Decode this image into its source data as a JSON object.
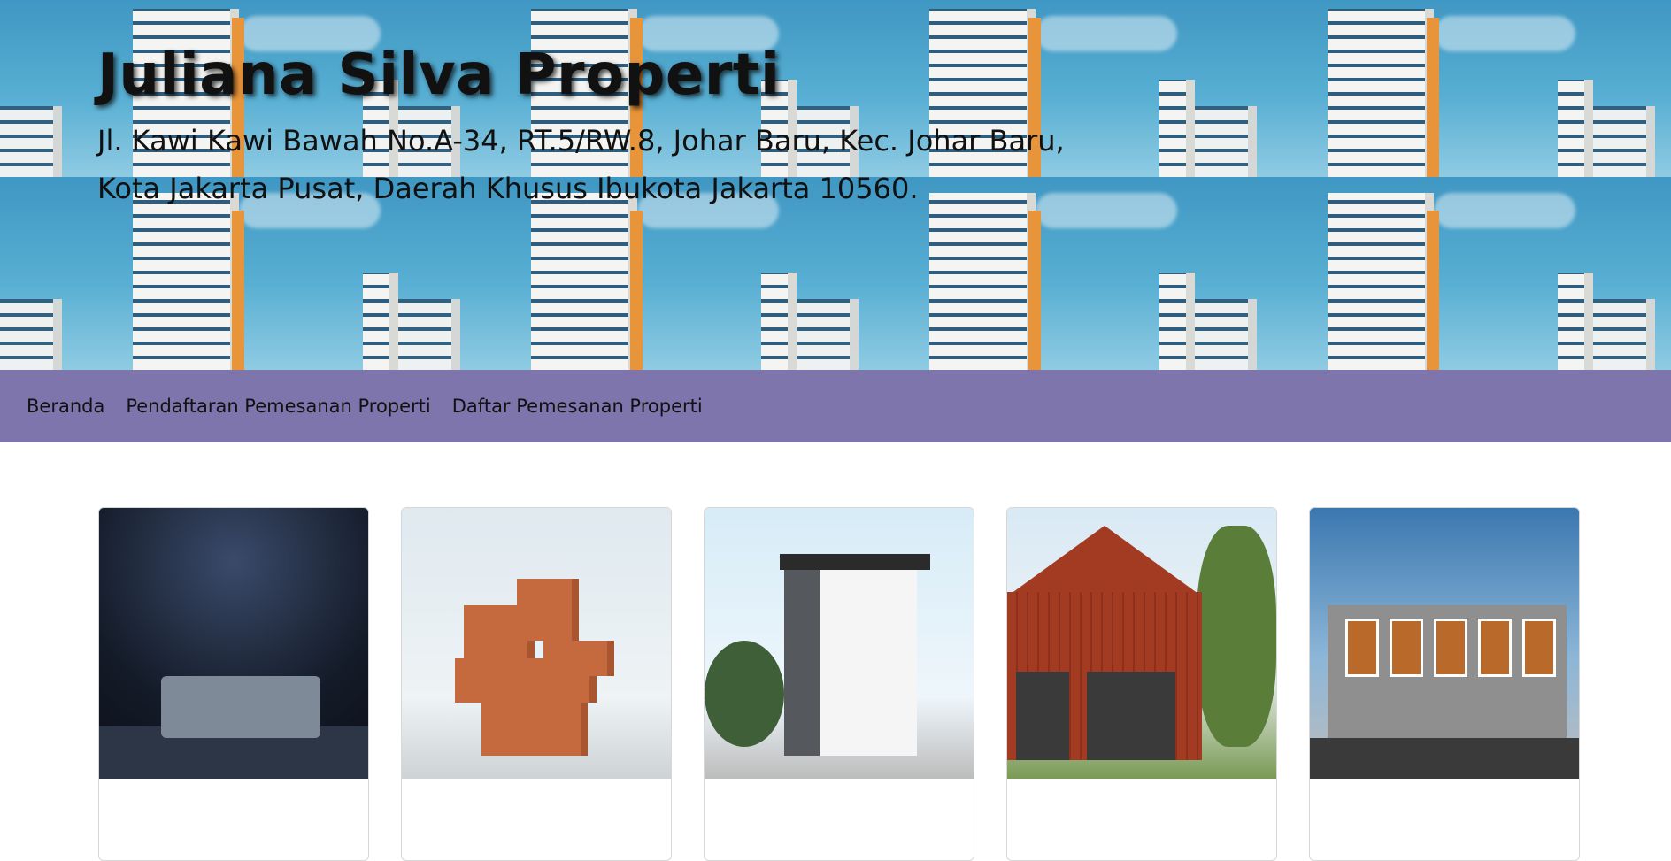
{
  "header": {
    "title": "Juliana Silva Properti",
    "address_line1": "Jl. Kawi Kawi Bawah No.A-34, RT.5/RW.8, Johar Baru, Kec. Johar Baru,",
    "address_line2": "Kota Jakarta Pusat, Daerah Khusus Ibukota Jakarta 10560."
  },
  "nav": {
    "items": [
      {
        "label": "Beranda"
      },
      {
        "label": "Pendaftaran Pemesanan Properti"
      },
      {
        "label": "Daftar Pemesanan Properti"
      }
    ]
  },
  "colors": {
    "navbar_bg": "#7e75ad",
    "hero_sky": "#4fa4c9",
    "page_bg": "#ffffff"
  }
}
